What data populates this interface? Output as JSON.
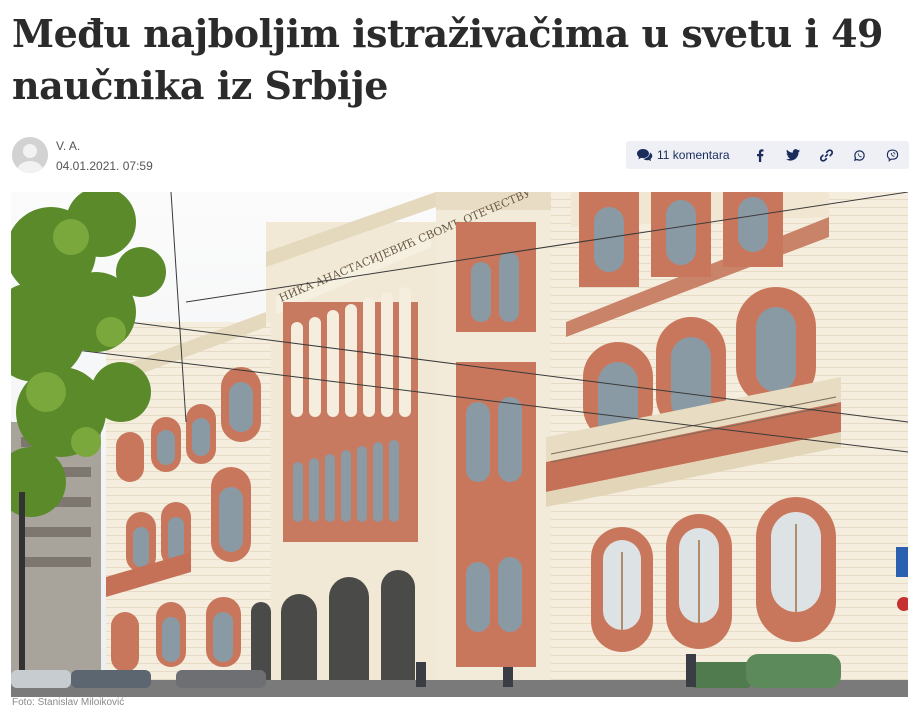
{
  "article": {
    "title": "Među najboljim istraživačima u svetu i 49 naučnika iz Srbije",
    "author": "V. A.",
    "date": "04.01.2021. 07:59",
    "building_inscription": "НИКА АНАСТАСИЈЕВИЋ СВОМЪ ОТЕЧЕСТВУ",
    "photo_caption": "Foto: Stanislav Milojković"
  },
  "share": {
    "comments_label": "11 komentara",
    "icons": [
      "comments-icon",
      "facebook-icon",
      "twitter-icon",
      "link-icon",
      "whatsapp-icon",
      "viber-icon"
    ]
  },
  "colors": {
    "accent": "#1a2b5c",
    "share_bg": "#eef0f6",
    "facade": "#f3ecdc",
    "brick": "#c8735a",
    "tree": "#5a8a2a",
    "sky": "#f4f4f4"
  }
}
